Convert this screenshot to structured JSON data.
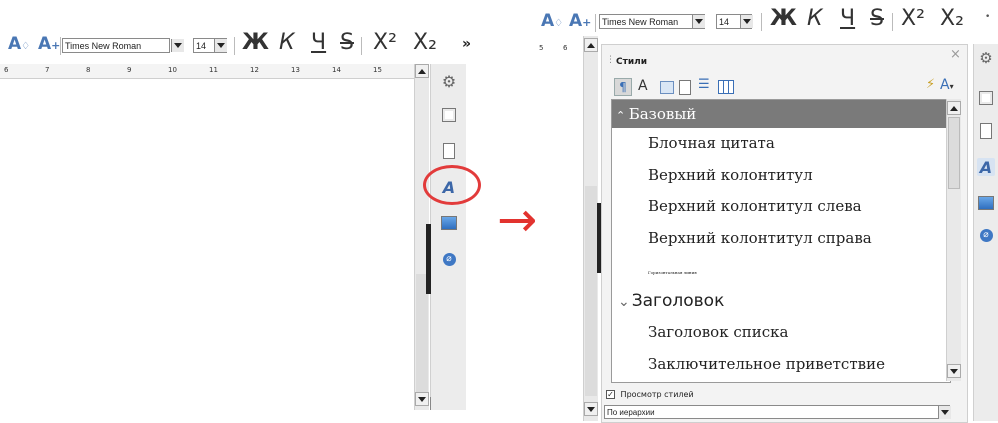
{
  "left": {
    "toolbar": {
      "font_name": "Times New Roman",
      "font_size": "14",
      "bold": "Ж",
      "italic": "К",
      "underline": "Ч",
      "strike": "S",
      "superscript": "X²",
      "subscript": "X₂",
      "more": "»"
    },
    "ruler_ticks": [
      "6",
      "7",
      "8",
      "9",
      "10",
      "11",
      "12",
      "13",
      "14",
      "15"
    ]
  },
  "arrow": "→",
  "right": {
    "toolbar": {
      "font_name": "Times New Roman",
      "font_size": "14",
      "bold": "Ж",
      "italic": "К",
      "underline": "Ч",
      "strike": "S",
      "superscript": "X²",
      "subscript": "X₂"
    },
    "ruler_ticks": [
      "5",
      "6"
    ],
    "panel": {
      "title": "Стили",
      "close": "×",
      "style_items": [
        "Базовый",
        "Блочная цитата",
        "Верхний колонтитул",
        "Верхний колонтитул слева",
        "Верхний колонтитул справа",
        "Горизонтальная линия",
        "Заголовок",
        "Заголовок списка",
        "Заключительное приветствие"
      ],
      "preview_label": "Просмотр стилей",
      "preview_checked": "✓",
      "filter_value": "По иерархии"
    }
  },
  "colors": {
    "accent": "#4a77b4",
    "highlight_ring": "#e23b3b",
    "arrow": "#e2332f",
    "selected_row": "#7a7a7a"
  }
}
